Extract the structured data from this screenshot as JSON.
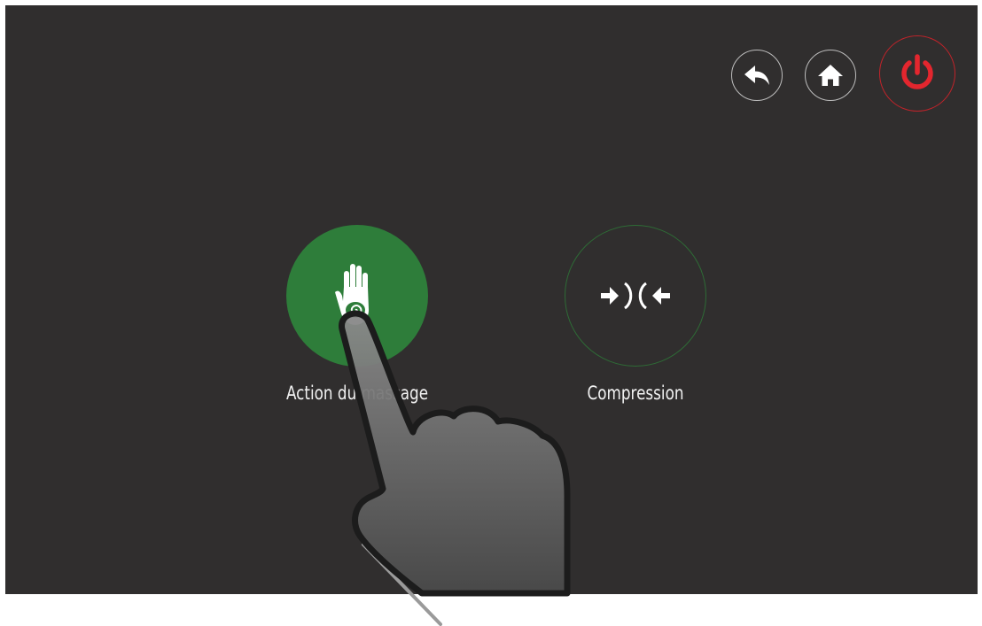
{
  "header": {
    "back_icon": "back-arrow-icon",
    "home_icon": "home-icon",
    "power_icon": "power-icon",
    "power_color": "#e3262e"
  },
  "modes": [
    {
      "label": "Action du massage",
      "icon": "hand-spiral-icon",
      "selected": true,
      "color": "#2e7d3a"
    },
    {
      "label": "Compression",
      "icon": "compression-arrows-icon",
      "selected": false,
      "color": "#2e6b36"
    }
  ],
  "colors": {
    "background": "#302e2e",
    "text": "#f2f2f2",
    "outline": "#bdbdbd"
  }
}
